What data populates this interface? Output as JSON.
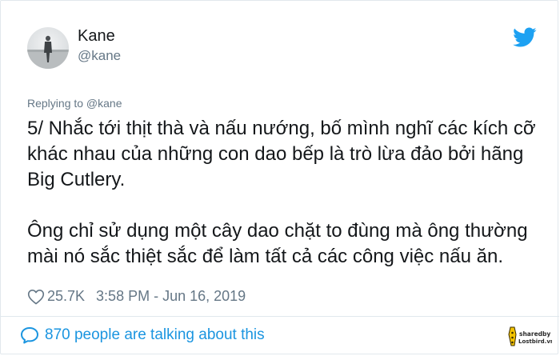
{
  "author": {
    "name": "Kane",
    "handle": "@kane"
  },
  "reply": {
    "label": "Replying to @kane"
  },
  "tweet": {
    "paragraphs": [
      "5/ Nhắc tới thịt thà và nấu nướng, bố mình nghĩ các kích cỡ khác nhau của những con dao bếp là trò lừa đảo bởi hãng Big Cutlery.",
      "Ông chỉ sử dụng một cây dao chặt to đùng mà ông thường mài nó sắc thiệt sắc để làm tất cả các công việc nấu ăn."
    ],
    "likes": "25.7K",
    "datetime": "3:58 PM - Jun 16, 2019"
  },
  "footer": {
    "talking": "870 people are talking about this"
  },
  "watermark": {
    "line1": "sharedby",
    "line2": "Lostbird.vn"
  },
  "icons": {
    "logo": "twitter-bird-icon",
    "like": "heart-outline-icon",
    "talk": "speech-bubble-icon"
  },
  "colors": {
    "text": "#14171a",
    "secondary": "#657786",
    "accent": "#1da1f2",
    "link": "#1b95e0",
    "border": "#e1e8ed"
  }
}
